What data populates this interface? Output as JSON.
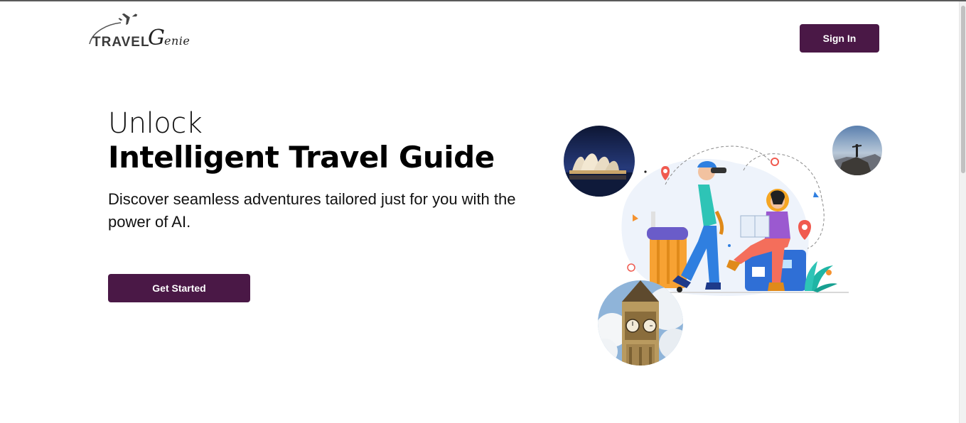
{
  "header": {
    "logo_travel": "TRAVEL",
    "logo_genie_cap": "G",
    "logo_genie_rest": "enie",
    "signin_label": "Sign In"
  },
  "hero": {
    "line1": "Unlock",
    "line2": "Intelligent Travel Guide",
    "subtitle": "Discover seamless adventures tailored just for you with the power of AI.",
    "cta_label": "Get Started"
  },
  "colors": {
    "brand": "#4a1846",
    "text": "#000000",
    "background": "#ffffff"
  },
  "icons": {
    "logo_plane": "airplane-icon",
    "map_pins": "location-pin-icon"
  }
}
